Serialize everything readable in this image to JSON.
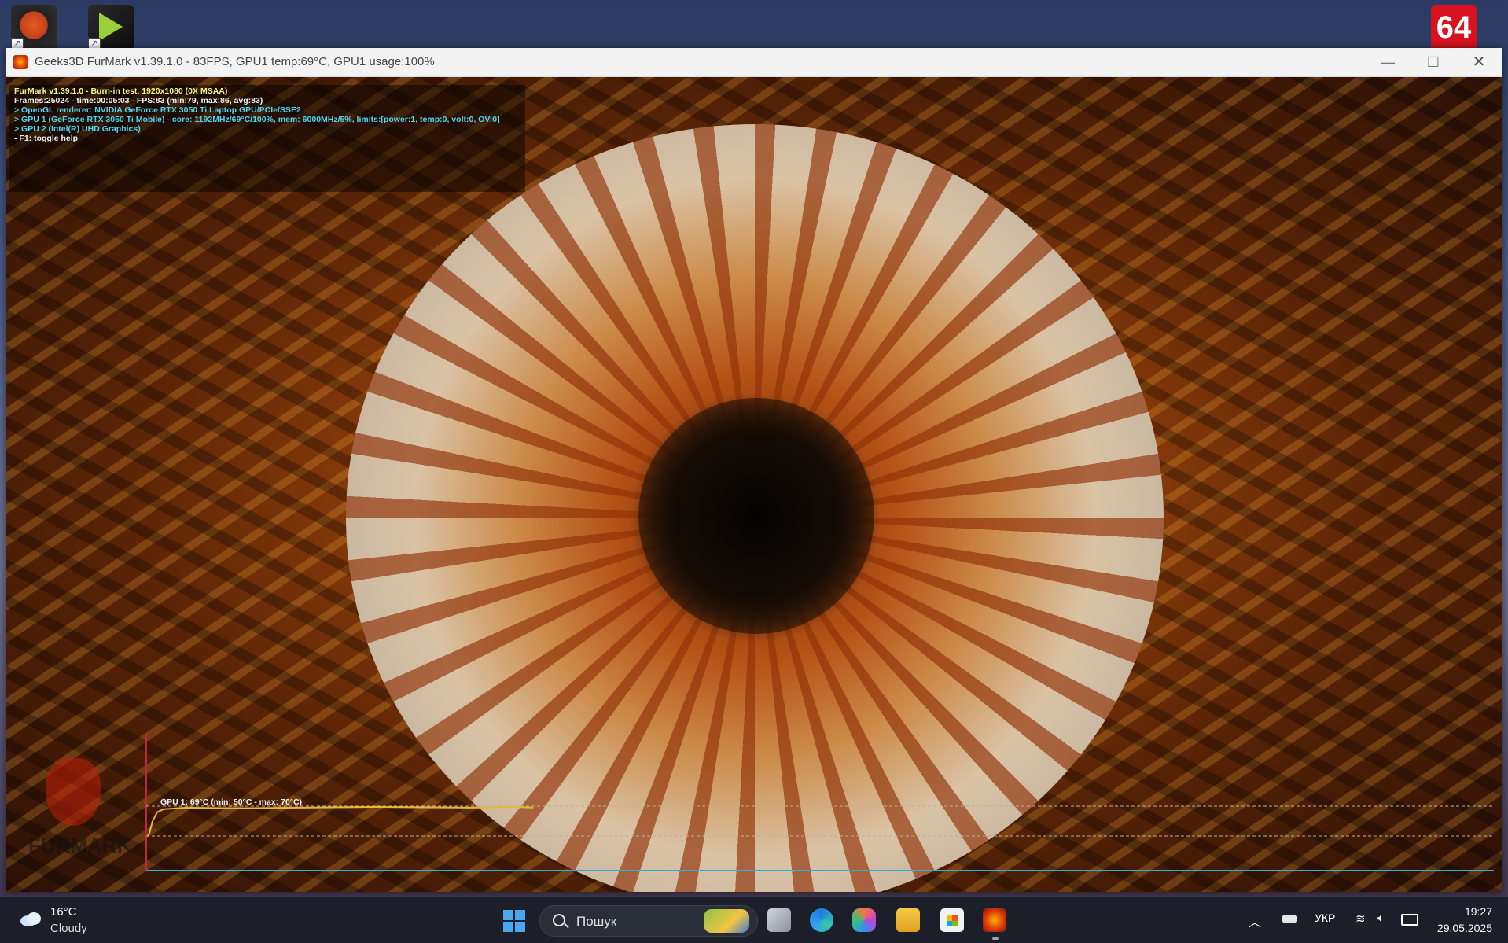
{
  "desktop": {
    "icons": [
      {
        "name": "furmark-shortcut"
      },
      {
        "name": "nvidia-shortcut"
      },
      {
        "name": "aida64-shortcut",
        "label": "64"
      }
    ]
  },
  "window": {
    "title": "Geeks3D FurMark v1.39.1.0 - 83FPS, GPU1 temp:69°C, GPU1 usage:100%",
    "controls": {
      "minimize": "—",
      "maximize": "☐",
      "close": "✕"
    }
  },
  "osd": {
    "lines": [
      {
        "text": "FurMark v1.39.1.0 - Burn-in test, 1920x1080 (0X MSAA)",
        "color": "yellow"
      },
      {
        "text": "Frames:25024 - time:00:05:03 - FPS:83 (min:79, max:86, avg:83)",
        "color": "white"
      },
      {
        "text": "> OpenGL renderer: NVIDIA GeForce RTX 3050 Ti Laptop GPU/PCIe/SSE2",
        "color": "cyan"
      },
      {
        "text": "> GPU 1 (GeForce RTX 3050 Ti Mobile) - core: 1192MHz/69°C/100%, mem: 6000MHz/5%, limits:[power:1, temp:0, volt:0, OV:0]",
        "color": "cyan"
      },
      {
        "text": "> GPU 2 (Intel(R) UHD Graphics)",
        "color": "cyan"
      },
      {
        "text": "- F1: toggle help",
        "color": "white"
      }
    ]
  },
  "temp_graph": {
    "label": "GPU 1: 69°C (min: 50°C - max: 70°C)",
    "current": 69,
    "min": 50,
    "max": 70,
    "line_color": "#e8b43a"
  },
  "furmark_logo_text": "FURMARK",
  "taskbar": {
    "weather": {
      "temp": "16°C",
      "condition": "Cloudy"
    },
    "search_placeholder": "Пошук",
    "apps": [
      "task-view",
      "edge",
      "copilot",
      "file-explorer",
      "microsoft-store",
      "furmark"
    ],
    "tray": {
      "chevron": "︿",
      "language": "УКР",
      "wifi": "wifi-icon",
      "sound": "sound-icon",
      "time": "19:27",
      "date": "29.05.2025"
    }
  },
  "colors": {
    "osd_yellow": "#f4f38a",
    "osd_cyan": "#4fd4f0",
    "graph_axis": "#c0283a",
    "graph_baseline": "#3aa9d6"
  }
}
